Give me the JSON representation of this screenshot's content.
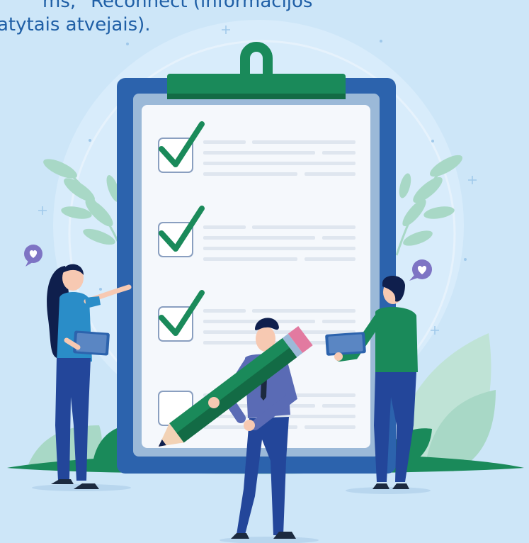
{
  "heading": {
    "line1": "ms, “Reconnect (informacijos",
    "line2": "atytais atvejais)."
  },
  "checklist": {
    "items": [
      {
        "checked": true
      },
      {
        "checked": true
      },
      {
        "checked": true
      },
      {
        "checked": false
      }
    ]
  },
  "colors": {
    "background": "#cde6f8",
    "heading_text": "#1f5fa6",
    "clipboard_board": "#2c63ad",
    "clip": "#1a8a5a",
    "check": "#1a8a5a",
    "paper": "#f5f8fc",
    "leaves": "#a8d8c6"
  },
  "icons": [
    "heart-bubble-icon",
    "heart-bubble-icon",
    "sparkle-plus-icon",
    "checkmark-icon"
  ]
}
